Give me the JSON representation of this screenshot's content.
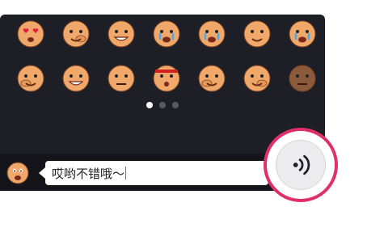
{
  "emoji_grid": {
    "rows": [
      [
        "heart-eyes-face-icon",
        "covering-eyes-face-icon",
        "big-grin-face-icon",
        "crying-face-icon",
        "laughing-tears-face-icon",
        "blushing-face-icon",
        "sobbing-face-icon"
      ],
      [
        "picking-nose-face-icon",
        "smirk-face-icon",
        "unimpressed-face-icon",
        "headband-angry-face-icon",
        "coughing-face-icon",
        "thinking-face-icon",
        "dark-speechless-face-icon"
      ]
    ]
  },
  "pagination": {
    "pages": 3,
    "current": 1
  },
  "input": {
    "message_text": "哎哟不错哦～"
  },
  "voice_button": {
    "icon": "sound-wave-icon"
  },
  "colors": {
    "panel_bg": "#1e1e26",
    "highlight_ring": "#e0306a",
    "face": "#f0a86a"
  }
}
